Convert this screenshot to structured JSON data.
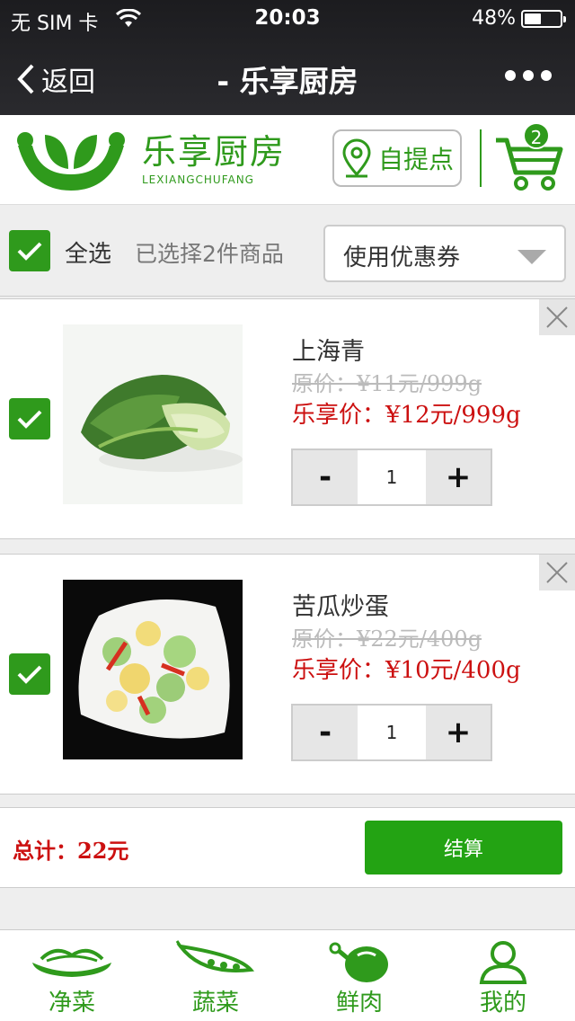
{
  "status_bar": {
    "carrier": "无 SIM 卡",
    "time": "20:03",
    "battery": "48%"
  },
  "nav": {
    "back_label": "返回",
    "title": "- 乐享厨房"
  },
  "header": {
    "logo_cn": "乐享厨房",
    "logo_en": "LEXIANGCHUFANG",
    "pickup_label": "自提点",
    "cart_count": "2"
  },
  "select_bar": {
    "select_all_label": "全选",
    "selected_count_text": "已选择2件商品",
    "coupon_label": "使用优惠券"
  },
  "items": [
    {
      "name": "上海青",
      "original_price": "原价：¥11元/999g",
      "deal_price": "乐享价：¥12元/999g",
      "quantity": "1",
      "checked": true
    },
    {
      "name": "苦瓜炒蛋",
      "original_price": "原价：¥22元/400g",
      "deal_price": "乐享价：¥10元/400g",
      "quantity": "1",
      "checked": true
    }
  ],
  "qty_controls": {
    "minus": "-",
    "plus": "+"
  },
  "footer": {
    "total_text": "总计：22元",
    "checkout_label": "结算"
  },
  "tabs": [
    {
      "label": "净菜",
      "icon": "noodle-bowl-icon"
    },
    {
      "label": "蔬菜",
      "icon": "pea-pod-icon"
    },
    {
      "label": "鲜肉",
      "icon": "meat-leg-icon"
    },
    {
      "label": "我的",
      "icon": "user-icon"
    }
  ],
  "colors": {
    "brand_green": "#2f9a1c",
    "price_red": "#cc1010",
    "nav_bg": "#1c1c1f"
  }
}
